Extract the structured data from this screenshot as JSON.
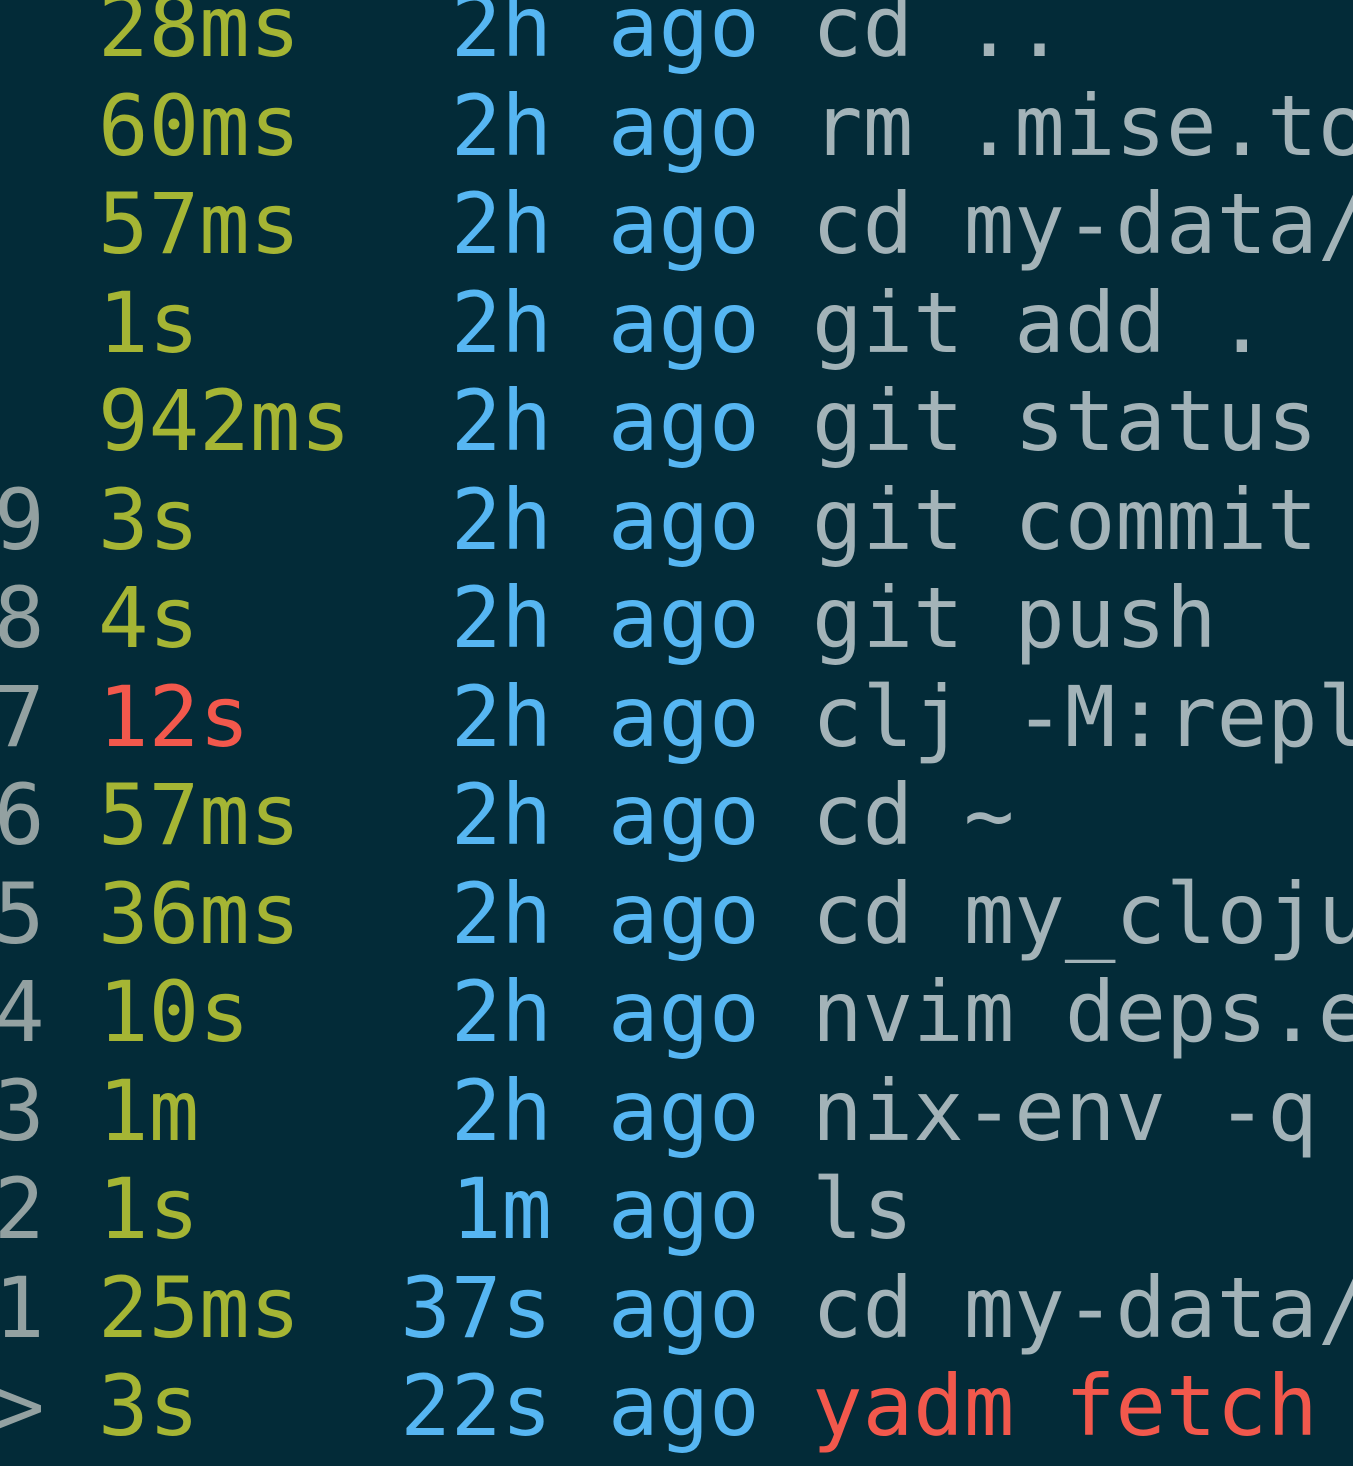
{
  "history": {
    "rows": [
      {
        "index": "",
        "duration": "28ms",
        "time": "2h",
        "ago": "ago",
        "command": "cd ..",
        "slow": false
      },
      {
        "index": "",
        "duration": "60ms",
        "time": "2h",
        "ago": "ago",
        "command": "rm .mise.to",
        "slow": false
      },
      {
        "index": "",
        "duration": "57ms",
        "time": "2h",
        "ago": "ago",
        "command": "cd my-data/",
        "slow": false
      },
      {
        "index": "",
        "duration": "1s",
        "time": "2h",
        "ago": "ago",
        "command": "git add .",
        "slow": false
      },
      {
        "index": "",
        "duration": "942ms",
        "time": "2h",
        "ago": "ago",
        "command": "git status",
        "slow": false
      },
      {
        "index": "9",
        "duration": "3s",
        "time": "2h",
        "ago": "ago",
        "command": "git commit",
        "slow": false
      },
      {
        "index": "8",
        "duration": "4s",
        "time": "2h",
        "ago": "ago",
        "command": "git push",
        "slow": false
      },
      {
        "index": "7",
        "duration": "12s",
        "time": "2h",
        "ago": "ago",
        "command": "clj -M:repl",
        "slow": true
      },
      {
        "index": "6",
        "duration": "57ms",
        "time": "2h",
        "ago": "ago",
        "command": "cd ~",
        "slow": false
      },
      {
        "index": "5",
        "duration": "36ms",
        "time": "2h",
        "ago": "ago",
        "command": "cd my_cloju",
        "slow": false
      },
      {
        "index": "4",
        "duration": "10s",
        "time": "2h",
        "ago": "ago",
        "command": "nvim deps.e",
        "slow": false
      },
      {
        "index": "3",
        "duration": "1m",
        "time": "2h",
        "ago": "ago",
        "command": "nix-env -q",
        "slow": false
      },
      {
        "index": "2",
        "duration": "1s",
        "time": "1m",
        "ago": "ago",
        "command": "ls",
        "slow": false
      },
      {
        "index": "1",
        "duration": "25ms",
        "time": "37s",
        "ago": "ago",
        "command": "cd my-data/",
        "slow": false
      },
      {
        "index": ">",
        "duration": "3s",
        "time": "22s",
        "ago": "ago",
        "command": "yadm fetch",
        "slow": false,
        "selected": true
      }
    ]
  },
  "colors": {
    "background": "#032b38",
    "duration": "#a5b534",
    "slow_duration": "#f2584c",
    "time": "#56b6f2",
    "command": "#a3b3b8",
    "selected_command": "#f2584c",
    "index": "#93a1a1"
  }
}
